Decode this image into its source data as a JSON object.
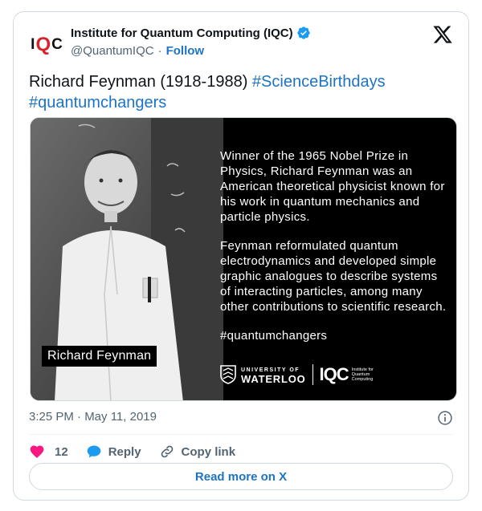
{
  "author": {
    "display_name": "Institute for Quantum Computing (IQC)",
    "handle": "@QuantumIQC",
    "separator": "·",
    "follow_label": "Follow",
    "avatar_logo": "IQC"
  },
  "tweet": {
    "text_plain": "Richard Feynman (1918-1988) ",
    "hashtag_1": "#ScienceBirthdays",
    "hashtag_2": "#quantumchangers",
    "timestamp": "3:25 PM · May 11, 2019"
  },
  "media": {
    "photo_caption": "Richard Feynman",
    "paragraph_1": "Winner of the 1965 Nobel Prize in Physics, Richard Feynman was an American theoretical physicist known for his work in quantum mechanics and particle physics.",
    "paragraph_2": "Feynman reformulated quantum electrodynamics and developed simple graphic analogues to describe systems of interacting particles, among many other contributions to scientific research.",
    "hashtag": "#quantumchangers",
    "uw_small": "UNIVERSITY OF",
    "uw_big": "WATERLOO",
    "iqc_logo": "IQC",
    "iqc_sub_1": "Institute for",
    "iqc_sub_2": "Quantum",
    "iqc_sub_3": "Computing"
  },
  "actions": {
    "like_count": "12",
    "reply_label": "Reply",
    "copy_label": "Copy link",
    "read_more_label": "Read more on X"
  },
  "icons": {
    "verified": "verified-badge-icon",
    "x_logo": "x-logo-icon",
    "info": "info-icon",
    "like": "heart-icon",
    "reply": "reply-bubble-icon",
    "copy": "link-icon"
  },
  "colors": {
    "accent": "#1d73c4",
    "like": "#f91880",
    "iqc_red": "#d8232a"
  }
}
